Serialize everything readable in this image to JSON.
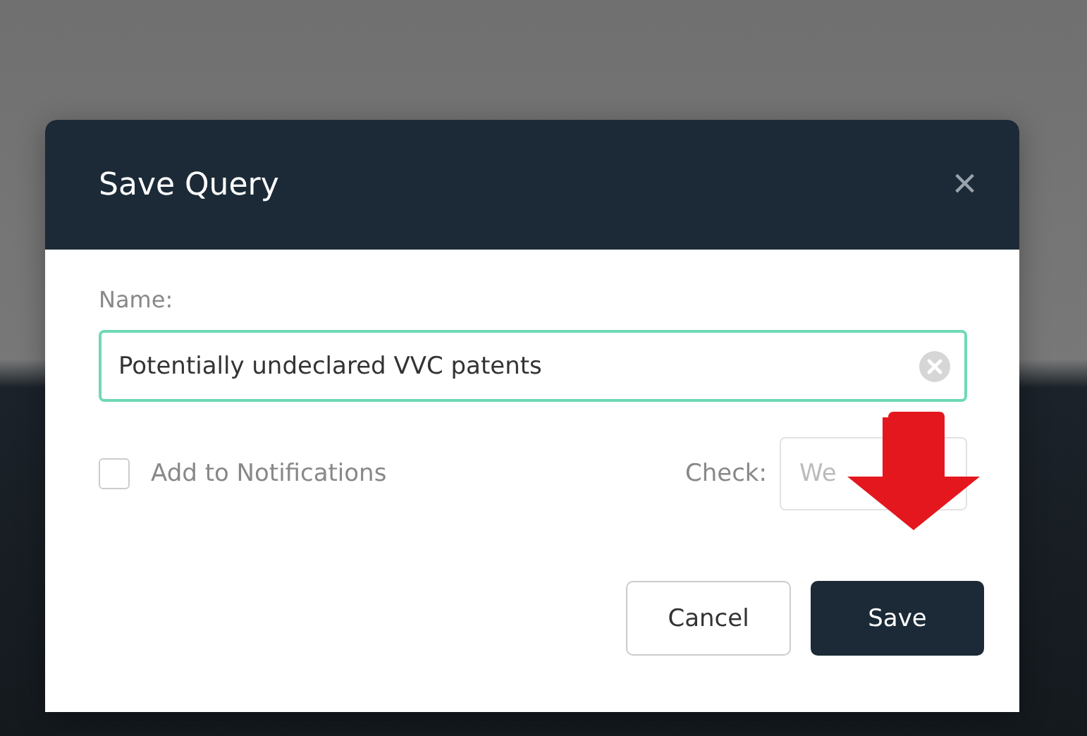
{
  "dialog": {
    "title": "Save Query",
    "close_icon": "×",
    "name_label": "Name:",
    "name_value": "Potentially undeclared VVC patents",
    "notifications": {
      "label": "Add to Notifications",
      "checked": false
    },
    "check": {
      "label": "Check:",
      "value": "We"
    },
    "buttons": [
      {
        "label": "Cancel",
        "kind": "secondary"
      },
      {
        "label": "Save",
        "kind": "primary"
      }
    ]
  }
}
